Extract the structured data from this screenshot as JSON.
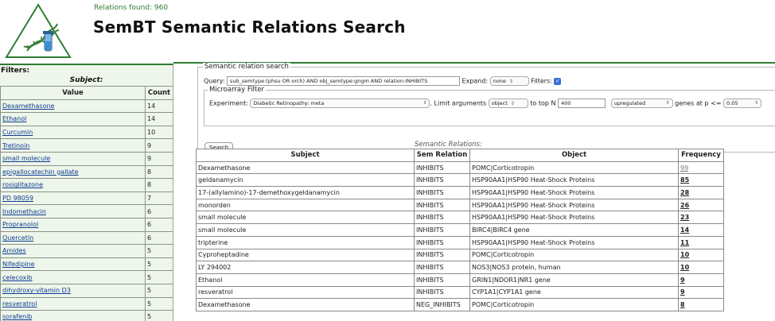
{
  "header": {
    "relations_found": "Relations found: 960",
    "title": "SemBT Semantic Relations Search"
  },
  "filters": {
    "title": "Filters:",
    "subject_heading": "Subject:",
    "columns": [
      "Value",
      "Count"
    ],
    "rows": [
      {
        "value": "Dexamethasone",
        "count": "14"
      },
      {
        "value": "Ethanol",
        "count": "14"
      },
      {
        "value": "Curcumin",
        "count": "10"
      },
      {
        "value": "Tretinoin",
        "count": "9"
      },
      {
        "value": "small molecule",
        "count": "9"
      },
      {
        "value": "epigallocatechin gallate",
        "count": "8"
      },
      {
        "value": "rosiglitazone",
        "count": "8"
      },
      {
        "value": "PD 98059",
        "count": "7"
      },
      {
        "value": "Indomethacin",
        "count": "6"
      },
      {
        "value": "Propranolol",
        "count": "6"
      },
      {
        "value": "Quercetin",
        "count": "6"
      },
      {
        "value": "Amides",
        "count": "5"
      },
      {
        "value": "Nifedipine",
        "count": "5"
      },
      {
        "value": "celecoxib",
        "count": "5"
      },
      {
        "value": "dihydroxy-vitamin D3",
        "count": "5"
      },
      {
        "value": "resveratrol",
        "count": "5"
      },
      {
        "value": "sorafenib",
        "count": "5"
      }
    ]
  },
  "search": {
    "legend": "Semantic relation search",
    "query_label": "Query:",
    "query_value": "sub_semtype:(phsu OR orch) AND obj_semtype:gngm AND relation:INHIBITS",
    "expand_label": "Expand:",
    "expand_value": "none",
    "filters_label": "Filters:",
    "microarray": {
      "legend": "Microarray Filter",
      "experiment_label": "Experiment:",
      "experiment_value": "Diabetic Retinopathy: meta",
      "limit_label": ". Limit arguments",
      "limit_value": "object",
      "top_label": "to top N",
      "top_value": "400",
      "direction_value": "upregulated",
      "genes_label": "genes at p <=",
      "p_value": "0.05"
    },
    "search_button": "Search"
  },
  "results": {
    "caption": "Semantic Relations:",
    "columns": [
      "Subject",
      "Sem Relation",
      "Object",
      "Frequency"
    ],
    "rows": [
      {
        "subject": "Dexamethasone",
        "relation": "INHIBITS",
        "object": "POMC|Corticotropin",
        "frequency": "99"
      },
      {
        "subject": "geldanamycin",
        "relation": "INHIBITS",
        "object": "HSP90AA1|HSP90 Heat-Shock Proteins",
        "frequency": "85"
      },
      {
        "subject": "17-(allylamino)-17-demethoxygeldanamycin",
        "relation": "INHIBITS",
        "object": "HSP90AA1|HSP90 Heat-Shock Proteins",
        "frequency": "28"
      },
      {
        "subject": "monorden",
        "relation": "INHIBITS",
        "object": "HSP90AA1|HSP90 Heat-Shock Proteins",
        "frequency": "26"
      },
      {
        "subject": "small molecule",
        "relation": "INHIBITS",
        "object": "HSP90AA1|HSP90 Heat-Shock Proteins",
        "frequency": "23"
      },
      {
        "subject": "small molecule",
        "relation": "INHIBITS",
        "object": "BIRC4|BIRC4 gene",
        "frequency": "14"
      },
      {
        "subject": "tripterine",
        "relation": "INHIBITS",
        "object": "HSP90AA1|HSP90 Heat-Shock Proteins",
        "frequency": "11"
      },
      {
        "subject": "Cyproheptadine",
        "relation": "INHIBITS",
        "object": "POMC|Corticotropin",
        "frequency": "10"
      },
      {
        "subject": "LY 294002",
        "relation": "INHIBITS",
        "object": "NOS3|NOS3 protein, human",
        "frequency": "10"
      },
      {
        "subject": "Ethanol",
        "relation": "INHIBITS",
        "object": "GRIN1|NDOR1|NR1 gene",
        "frequency": "9"
      },
      {
        "subject": "resveratrol",
        "relation": "INHIBITS",
        "object": "CYP1A1|CYP1A1 gene",
        "frequency": "9"
      },
      {
        "subject": "Dexamethasone",
        "relation": "NEG_INHIBITS",
        "object": "POMC|Corticotropin",
        "frequency": "8"
      }
    ]
  },
  "colors": {
    "accent": "#2e7d32",
    "filter_bg": "#eef5ea",
    "link": "#0b3d91"
  }
}
